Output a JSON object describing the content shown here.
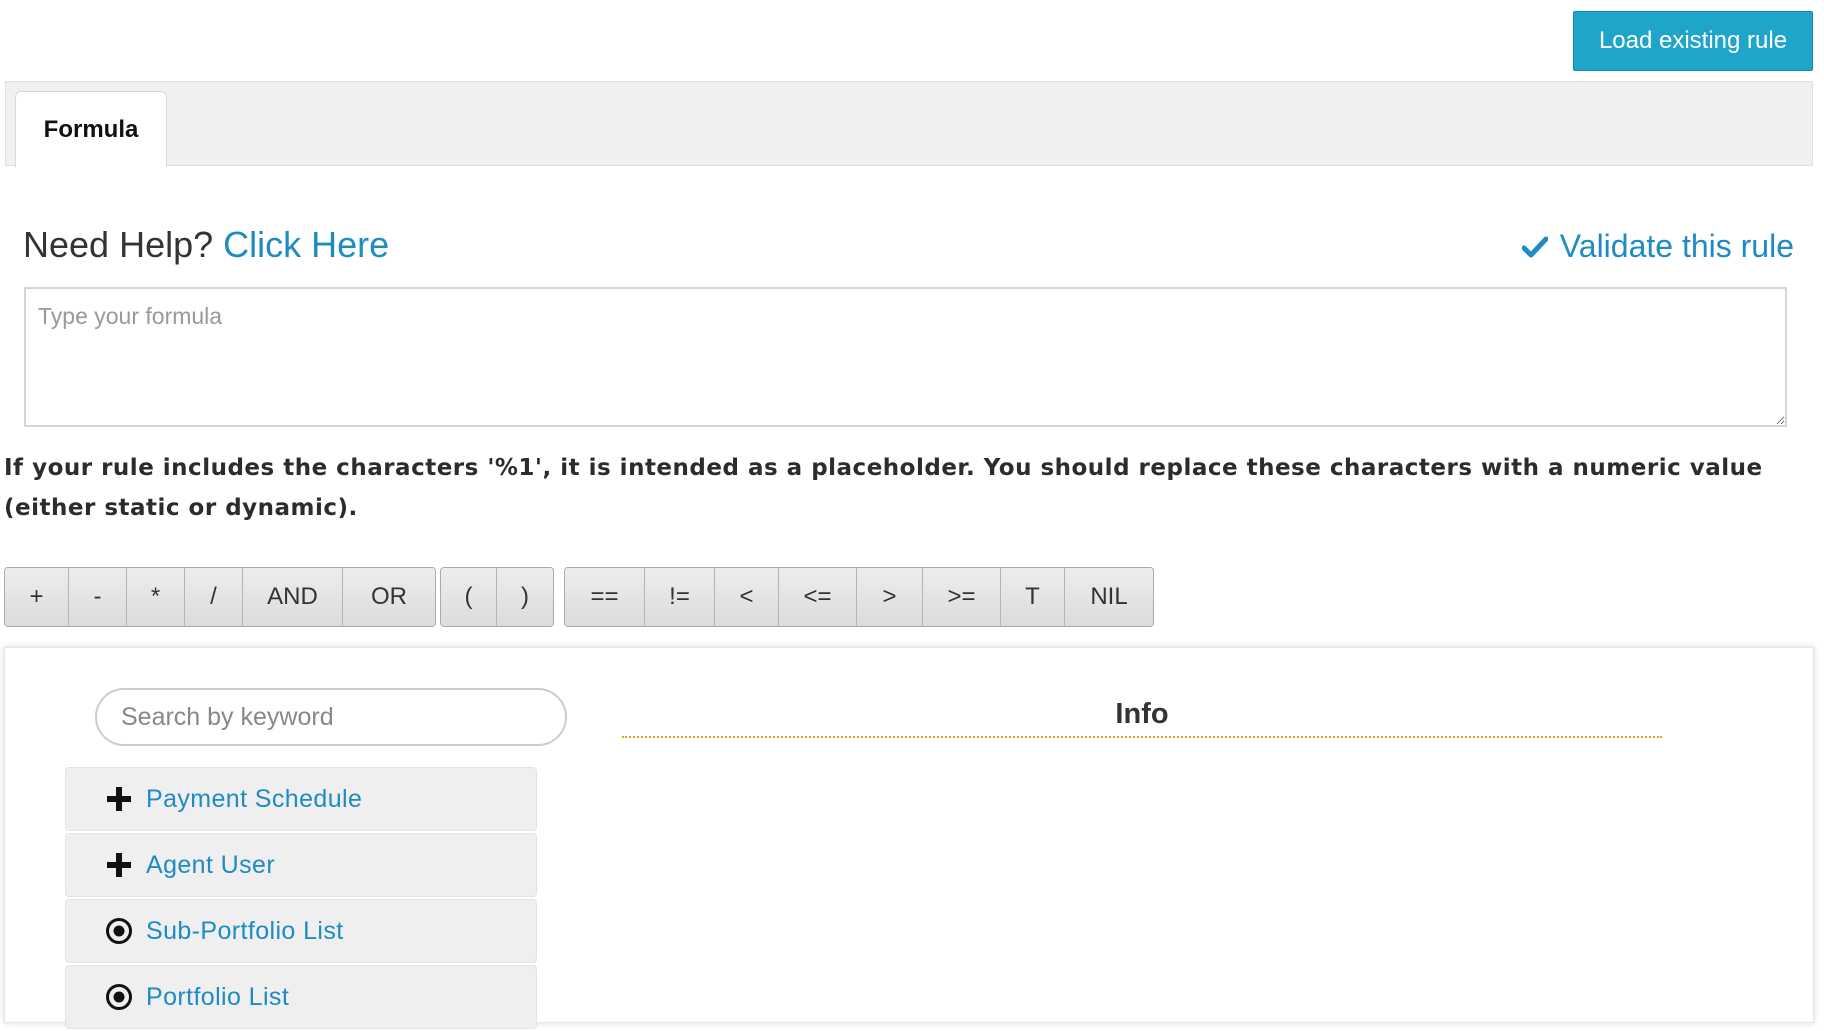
{
  "header": {
    "load_button": "Load existing rule"
  },
  "tabs": [
    {
      "label": "Formula",
      "active": true
    }
  ],
  "help": {
    "prefix": "Need Help?",
    "link": "Click Here"
  },
  "validate": {
    "label": "Validate this rule",
    "icon": "check-icon"
  },
  "formula": {
    "placeholder": "Type your formula",
    "value": ""
  },
  "note": "If your rule includes the characters '%1', it is intended as a placeholder. You should replace these characters with a numeric value (either static or dynamic).",
  "operators": {
    "arithmetic": [
      "+",
      "-",
      "*",
      "/",
      "AND",
      "OR"
    ],
    "parens": [
      "(",
      ")"
    ],
    "comparison": [
      "==",
      "!=",
      "<",
      "<=",
      ">",
      ">=",
      "T",
      "NIL"
    ]
  },
  "search": {
    "placeholder": "Search by keyword"
  },
  "tree_items": [
    {
      "label": "Payment Schedule",
      "icon": "plus-icon"
    },
    {
      "label": "Agent User",
      "icon": "plus-icon"
    },
    {
      "label": "Sub-Portfolio List",
      "icon": "radio-target-icon"
    },
    {
      "label": "Portfolio List",
      "icon": "radio-target-icon"
    }
  ],
  "info": {
    "title": "Info"
  },
  "colors": {
    "accent": "#1fa5c9",
    "link": "#1e8bc3",
    "info_rule": "#e0a020"
  }
}
